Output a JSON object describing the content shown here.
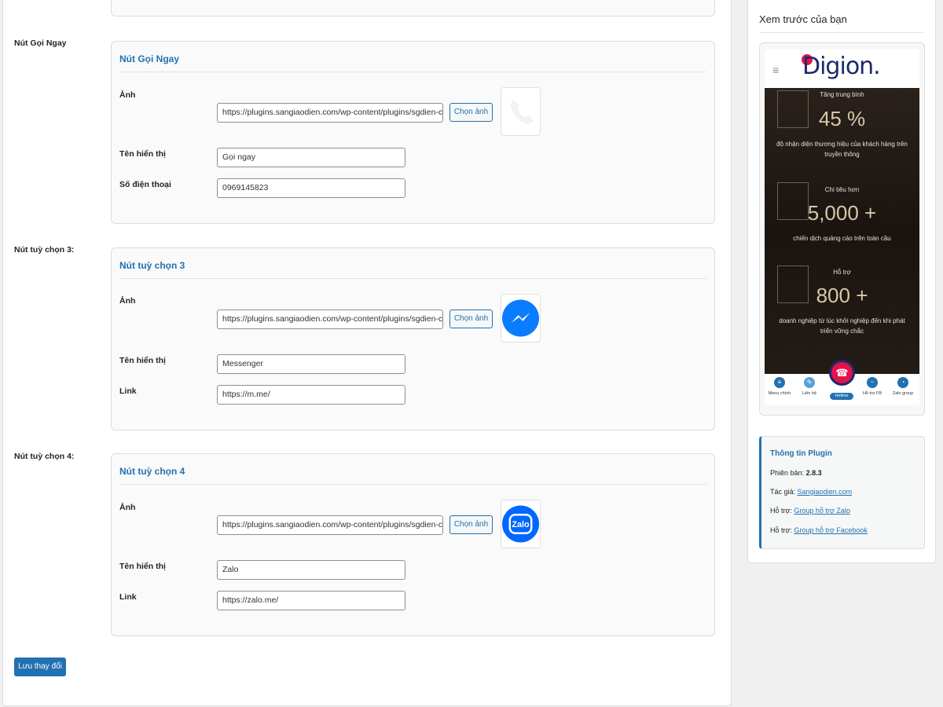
{
  "form": {
    "call_row_label": "Nút Gọi Ngay",
    "call_card": {
      "title": "Nút Gọi Ngay",
      "image_label": "Ảnh",
      "image_url": "https://plugins.sangiaodien.com/wp-content/plugins/sgdien-contact",
      "choose_label": "Chọn ảnh",
      "display_name_label": "Tên hiển thị",
      "display_name": "Gọi ngay",
      "phone_label": "Số điện thoại",
      "phone": "0969145823"
    },
    "opt3_row_label": "Nút tuỳ chọn 3:",
    "opt3_card": {
      "title": "Nút tuỳ chọn 3",
      "image_label": "Ảnh",
      "image_url": "https://plugins.sangiaodien.com/wp-content/plugins/sgdien-contact",
      "choose_label": "Chọn ảnh",
      "display_name_label": "Tên hiển thị",
      "display_name": "Messenger",
      "link_label": "Link",
      "link": "https://m.me/"
    },
    "opt4_row_label": "Nút tuỳ chọn 4:",
    "opt4_card": {
      "title": "Nút tuỳ chọn 4",
      "image_label": "Ảnh",
      "image_url": "https://plugins.sangiaodien.com/wp-content/plugins/sgdien-contact",
      "choose_label": "Chọn ảnh",
      "display_name_label": "Tên hiển thị",
      "display_name": "Zalo",
      "link_label": "Link",
      "link": "https://zalo.me/"
    },
    "save_label": "Lưu thay đổi"
  },
  "preview": {
    "title": "Xem trước của bạn",
    "logo_text": "Digion.",
    "stats": [
      {
        "caption": "Tăng trung bình",
        "value": "45 %",
        "desc": "độ nhận diện thương hiệu của khách hàng trên truyền thông"
      },
      {
        "caption": "Chi tiêu hơn",
        "value": "5,000 +",
        "desc": "chiến dịch quảng cáo trên toàn cầu"
      },
      {
        "caption": "Hỗ trợ",
        "value": "800 +",
        "desc": "doanh nghiệp từ lúc khởi nghiệp đến khi phát triển vững chắc"
      }
    ],
    "nav": [
      {
        "label": "Menu chính",
        "icon": "menu-icon"
      },
      {
        "label": "Liên hệ",
        "icon": "edit-icon"
      },
      {
        "label": "Hotline",
        "icon": "phone-icon"
      },
      {
        "label": "Hỗ trợ FB",
        "icon": "messenger-icon"
      },
      {
        "label": "Zalo group",
        "icon": "zalo-icon"
      }
    ]
  },
  "plugin_info": {
    "title": "Thông tin Plugin",
    "version_label": "Phiên bản:",
    "version": "2.8.3",
    "author_label": "Tác giả:",
    "author": "Sangiaodien.com",
    "support_label_1": "Hỗ trợ:",
    "support_zalo": "Group hỗ trợ Zalo",
    "support_label_2": "Hỗ trợ:",
    "support_fb": "Group hỗ trợ Facebook"
  },
  "colors": {
    "accent": "#2271b1",
    "messenger": "#0a7cff",
    "zalo": "#0068ff",
    "hotline": "#e2134a"
  }
}
